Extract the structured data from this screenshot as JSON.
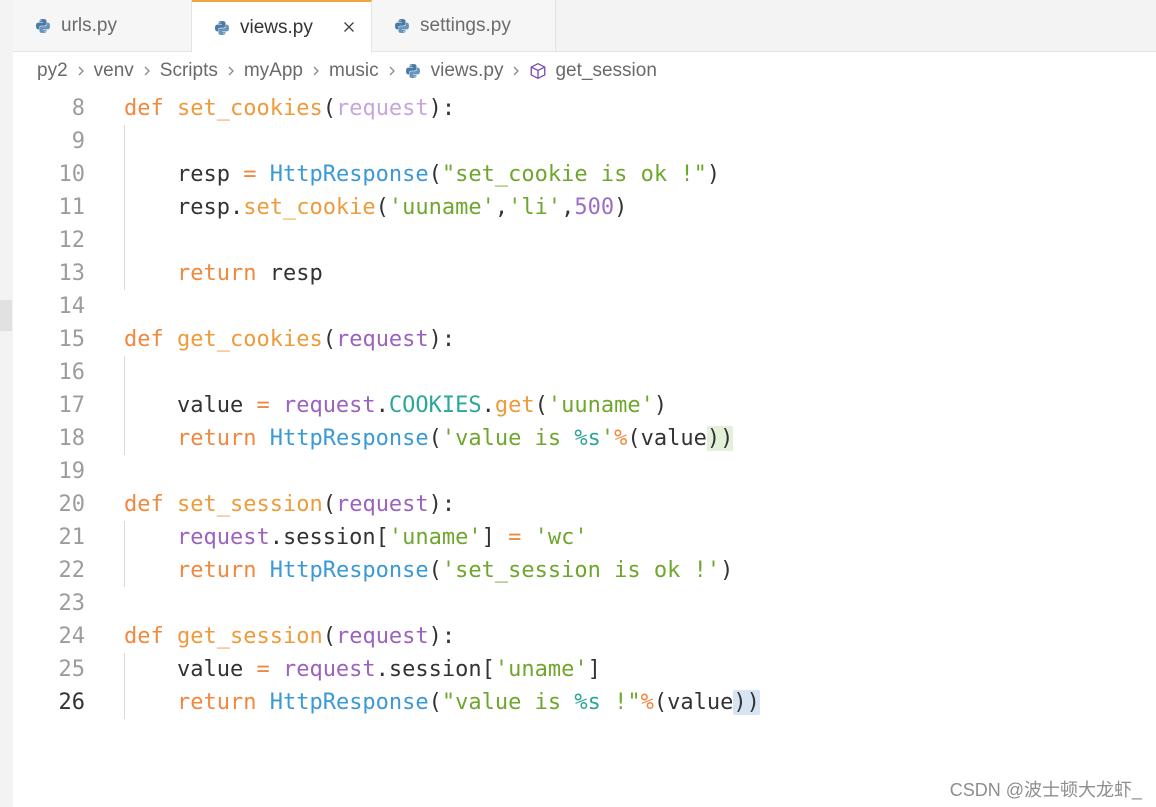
{
  "tabs": [
    {
      "label": "urls.py",
      "icon": "python-file-icon"
    },
    {
      "label": "views.py",
      "icon": "python-file-icon",
      "active": true,
      "close_icon": "close-icon"
    },
    {
      "label": "settings.py",
      "icon": "python-file-icon"
    }
  ],
  "breadcrumb": {
    "segments": [
      "py2",
      "venv",
      "Scripts",
      "myApp",
      "music"
    ],
    "separator_icon": "chevron-right-icon",
    "file": {
      "label": "views.py",
      "icon": "python-file-icon"
    },
    "symbol": {
      "label": "get_session",
      "icon": "method-icon"
    }
  },
  "editor": {
    "active_line": 26,
    "lines": [
      {
        "n": 8,
        "tokens": [
          [
            "def",
            "keyword"
          ],
          [
            " ",
            "plain"
          ],
          [
            "set_cookies",
            "function"
          ],
          [
            "(",
            "punctuation"
          ],
          [
            "request",
            "parameter-unused"
          ],
          [
            "):",
            "punctuation"
          ]
        ]
      },
      {
        "n": 9,
        "tokens": []
      },
      {
        "n": 10,
        "tokens": [
          [
            "    resp ",
            "plain"
          ],
          [
            "=",
            "operator"
          ],
          [
            " ",
            "plain"
          ],
          [
            "HttpResponse",
            "class"
          ],
          [
            "(",
            "punctuation"
          ],
          [
            "\"set_cookie is ok !\"",
            "string"
          ],
          [
            ")",
            "punctuation"
          ]
        ]
      },
      {
        "n": 11,
        "tokens": [
          [
            "    resp",
            "plain"
          ],
          [
            ".",
            "punctuation"
          ],
          [
            "set_cookie",
            "function"
          ],
          [
            "(",
            "punctuation"
          ],
          [
            "'uuname'",
            "string"
          ],
          [
            ",",
            "punctuation"
          ],
          [
            "'li'",
            "string"
          ],
          [
            ",",
            "punctuation"
          ],
          [
            "500",
            "number"
          ],
          [
            ")",
            "punctuation"
          ]
        ]
      },
      {
        "n": 12,
        "tokens": []
      },
      {
        "n": 13,
        "tokens": [
          [
            "    ",
            "plain"
          ],
          [
            "return",
            "keyword"
          ],
          [
            " resp",
            "plain"
          ]
        ]
      },
      {
        "n": 14,
        "tokens": []
      },
      {
        "n": 15,
        "tokens": [
          [
            "def",
            "keyword"
          ],
          [
            " ",
            "plain"
          ],
          [
            "get_cookies",
            "function"
          ],
          [
            "(",
            "punctuation"
          ],
          [
            "request",
            "parameter"
          ],
          [
            "):",
            "punctuation"
          ]
        ]
      },
      {
        "n": 16,
        "tokens": []
      },
      {
        "n": 17,
        "tokens": [
          [
            "    value ",
            "plain"
          ],
          [
            "=",
            "operator"
          ],
          [
            " ",
            "plain"
          ],
          [
            "request",
            "parameter"
          ],
          [
            ".",
            "punctuation"
          ],
          [
            "COOKIES",
            "constant"
          ],
          [
            ".",
            "punctuation"
          ],
          [
            "get",
            "function"
          ],
          [
            "(",
            "punctuation"
          ],
          [
            "'uuname'",
            "string"
          ],
          [
            ")",
            "punctuation"
          ]
        ]
      },
      {
        "n": 18,
        "tokens": [
          [
            "    ",
            "plain"
          ],
          [
            "return",
            "keyword"
          ],
          [
            " ",
            "plain"
          ],
          [
            "HttpResponse",
            "class"
          ],
          [
            "(",
            "punctuation"
          ],
          [
            "'value is ",
            "string"
          ],
          [
            "%s",
            "format"
          ],
          [
            "'",
            "string"
          ],
          [
            "%",
            "operator"
          ],
          [
            "(value",
            "plain"
          ],
          [
            "))",
            "bracket-match-green"
          ]
        ]
      },
      {
        "n": 19,
        "tokens": []
      },
      {
        "n": 20,
        "tokens": [
          [
            "def",
            "keyword"
          ],
          [
            " ",
            "plain"
          ],
          [
            "set_session",
            "function"
          ],
          [
            "(",
            "punctuation"
          ],
          [
            "request",
            "parameter"
          ],
          [
            "):",
            "punctuation"
          ]
        ]
      },
      {
        "n": 21,
        "tokens": [
          [
            "    ",
            "plain"
          ],
          [
            "request",
            "parameter"
          ],
          [
            ".",
            "punctuation"
          ],
          [
            "session",
            "plain"
          ],
          [
            "[",
            "punctuation"
          ],
          [
            "'uname'",
            "string"
          ],
          [
            "]",
            "punctuation"
          ],
          [
            " ",
            "plain"
          ],
          [
            "=",
            "operator"
          ],
          [
            " ",
            "plain"
          ],
          [
            "'wc'",
            "string"
          ]
        ]
      },
      {
        "n": 22,
        "tokens": [
          [
            "    ",
            "plain"
          ],
          [
            "return",
            "keyword"
          ],
          [
            " ",
            "plain"
          ],
          [
            "HttpResponse",
            "class"
          ],
          [
            "(",
            "punctuation"
          ],
          [
            "'set_session is ok !'",
            "string"
          ],
          [
            ")",
            "punctuation"
          ]
        ]
      },
      {
        "n": 23,
        "tokens": []
      },
      {
        "n": 24,
        "tokens": [
          [
            "def",
            "keyword"
          ],
          [
            " ",
            "plain"
          ],
          [
            "get_session",
            "function"
          ],
          [
            "(",
            "punctuation"
          ],
          [
            "request",
            "parameter"
          ],
          [
            "):",
            "punctuation"
          ]
        ]
      },
      {
        "n": 25,
        "tokens": [
          [
            "    value ",
            "plain"
          ],
          [
            "=",
            "operator"
          ],
          [
            " ",
            "plain"
          ],
          [
            "request",
            "parameter"
          ],
          [
            ".",
            "punctuation"
          ],
          [
            "session",
            "plain"
          ],
          [
            "[",
            "punctuation"
          ],
          [
            "'uname'",
            "string"
          ],
          [
            "]",
            "punctuation"
          ]
        ]
      },
      {
        "n": 26,
        "tokens": [
          [
            "    ",
            "plain"
          ],
          [
            "return",
            "keyword"
          ],
          [
            " ",
            "plain"
          ],
          [
            "HttpResponse",
            "class"
          ],
          [
            "(",
            "punctuation"
          ],
          [
            "\"value is ",
            "string"
          ],
          [
            "%s",
            "format"
          ],
          [
            " !\"",
            "string"
          ],
          [
            "%",
            "operator"
          ],
          [
            "(value",
            "plain"
          ],
          [
            "))",
            "bracket-match-blue"
          ]
        ]
      }
    ]
  },
  "watermark": "CSDN @波士顿大龙虾_",
  "colors": {
    "tab_active_border": "#f0a43c",
    "keyword": "#f0883e",
    "function": "#ee9b3c",
    "class": "#3b99d6",
    "string": "#6fa62d",
    "number": "#9b6ec6",
    "parameter": "#9c62bf",
    "parameter_unused": "#c8a6dd",
    "constant": "#2ba89a",
    "format": "#2ea59a",
    "operator": "#f0883e",
    "plain": "#333333",
    "punctuation": "#333333",
    "line_number": "#9c9c9c",
    "line_number_active": "#333333",
    "bracket_match_green": "#e3f1da",
    "bracket_match_blue": "#d6e4f4"
  }
}
